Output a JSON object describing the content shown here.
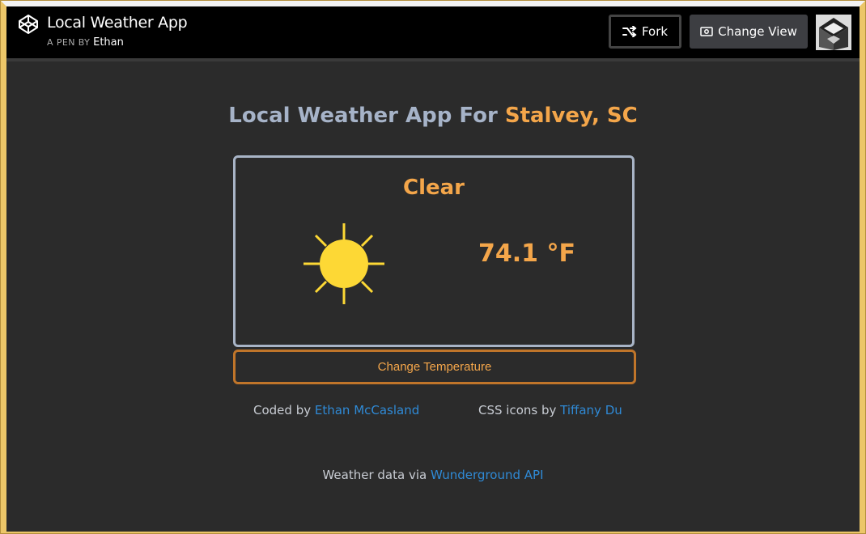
{
  "header": {
    "pen_title": "Local Weather App",
    "byline_prefix": "A PEN BY",
    "author": "Ethan",
    "fork_label": "Fork",
    "change_view_label": "Change View"
  },
  "weather": {
    "heading_prefix": "Local Weather App For",
    "city": "Stalvey, SC",
    "condition": "Clear",
    "temperature": "74.1 °F",
    "change_button_label": "Change Temperature"
  },
  "credits": {
    "coded_by_prefix": "Coded by",
    "coded_by_name": "Ethan McCasland",
    "icons_prefix": "CSS icons by",
    "icons_name": "Tiffany Du",
    "data_prefix": "Weather data via",
    "data_source": "Wunderground API"
  },
  "colors": {
    "accent_orange": "#f4a64a",
    "sun_yellow": "#fdd835",
    "link_blue": "#2f8ad6",
    "card_border": "#a8b4c6"
  },
  "icons": {
    "logo": "codepen-logo-icon",
    "fork": "fork-icon",
    "change_view": "eye-icon",
    "weather": "sun-icon"
  }
}
